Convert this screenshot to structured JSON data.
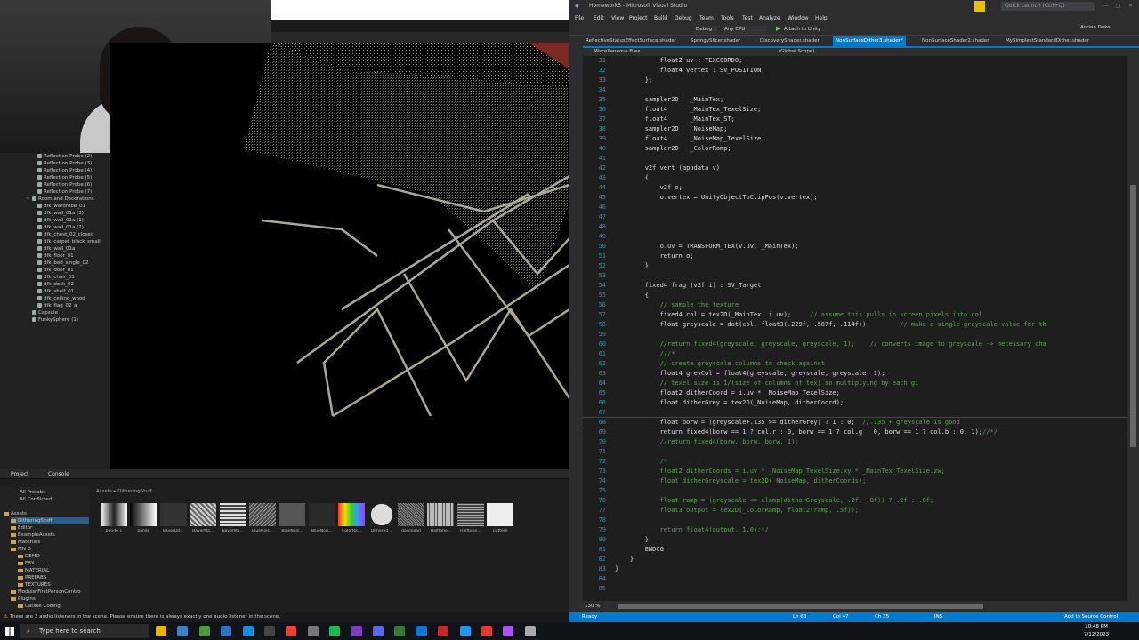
{
  "vs": {
    "title": "Homework5 - Microsoft Visual Studio",
    "quick_launch": "Quick Launch (Ctrl+Q)",
    "user": "Adrian Duke",
    "menu": [
      "File",
      "Edit",
      "View",
      "Project",
      "Build",
      "Debug",
      "Team",
      "Tools",
      "Test",
      "Analyze",
      "Window",
      "Help"
    ],
    "toolbar": {
      "config": "Debug",
      "platform": "Any CPU",
      "attach": "Attach to Unity"
    },
    "tabs": [
      "ReflectiveStatusEffectSurface.shader",
      "SpringySlicer.shader",
      "DiscoveryShader.shader",
      "NonSurfaceDither3.shader*",
      "NonSurfaceShader2.shader",
      "MySimplestStandardDither.shader"
    ],
    "nav_left": "Miscellaneous Files",
    "nav_scope": "(Global Scope)",
    "zoom": "130 %",
    "status": {
      "ready": "Ready",
      "ln": "Ln 68",
      "col": "Col 47",
      "ch": "Ch 35",
      "ins": "INS",
      "source": "Add to Source Control"
    },
    "code_lines": [
      {
        "n": "31",
        "t": "            float2 uv : TEXCOORD0;",
        "c": ""
      },
      {
        "n": "32",
        "t": "            float4 vertex : SV_POSITION;",
        "c": ""
      },
      {
        "n": "33",
        "t": "        };",
        "c": ""
      },
      {
        "n": "34",
        "t": "",
        "c": ""
      },
      {
        "n": "35",
        "t": "        sampler2D   _MainTex;",
        "c": ""
      },
      {
        "n": "36",
        "t": "        float4      _MainTex_TexelSize;",
        "c": ""
      },
      {
        "n": "37",
        "t": "        float4      _MainTex_ST;",
        "c": ""
      },
      {
        "n": "38",
        "t": "        sampler2D   _NoiseMap;",
        "c": ""
      },
      {
        "n": "39",
        "t": "        float4      _NoiseMap_TexelSize;",
        "c": ""
      },
      {
        "n": "40",
        "t": "        sampler2D   _ColorRamp;",
        "c": ""
      },
      {
        "n": "41",
        "t": "",
        "c": ""
      },
      {
        "n": "42",
        "t": "        v2f vert (appdata v)",
        "c": ""
      },
      {
        "n": "43",
        "t": "        {",
        "c": ""
      },
      {
        "n": "44",
        "t": "            v2f o;",
        "c": ""
      },
      {
        "n": "45",
        "t": "            o.vertex = UnityObjectToClipPos(v.vertex);",
        "c": ""
      },
      {
        "n": "46",
        "t": "",
        "c": ""
      },
      {
        "n": "47",
        "t": "",
        "c": ""
      },
      {
        "n": "48",
        "t": "",
        "c": ""
      },
      {
        "n": "49",
        "t": "",
        "c": ""
      },
      {
        "n": "50",
        "t": "            o.uv = TRANSFORM_TEX(v.uv, _MainTex);",
        "c": ""
      },
      {
        "n": "51",
        "t": "            return o;",
        "c": ""
      },
      {
        "n": "52",
        "t": "        }",
        "c": ""
      },
      {
        "n": "53",
        "t": "",
        "c": ""
      },
      {
        "n": "54",
        "t": "        fixed4 frag (v2f i) : SV_Target",
        "c": ""
      },
      {
        "n": "55",
        "t": "        {",
        "c": ""
      },
      {
        "n": "56",
        "t": "",
        "c": "            // sample the texture"
      },
      {
        "n": "57",
        "t": "            fixed4 col = tex2D(_MainTex, i.uv);     ",
        "c": "// assume this pulls in screen pixels into col"
      },
      {
        "n": "58",
        "t": "            float greyscale = dot(col, float3(.229f, .587f, .114f));        ",
        "c": "// make a single greyscale value for th"
      },
      {
        "n": "59",
        "t": "",
        "c": ""
      },
      {
        "n": "60",
        "t": "",
        "c": "            //return fixed4(greyscale, greyscale, greyscale, 1);    // converts image to greyscale -> necessary cha"
      },
      {
        "n": "61",
        "t": "",
        "c": "            ///*"
      },
      {
        "n": "62",
        "t": "",
        "c": "            // create greyscale columns to check against"
      },
      {
        "n": "63",
        "t": "            float4 greyCol = float4(greyscale, greyscale, greyscale, 1);",
        "c": ""
      },
      {
        "n": "64",
        "t": "",
        "c": "            // texel size is 1/(size of columns of tex) so multiplying by each gi"
      },
      {
        "n": "65",
        "t": "            float2 ditherCoord = i.uv * _NoiseMap_TexelSize;",
        "c": ""
      },
      {
        "n": "66",
        "t": "            float ditherGrey = tex2D(_NoiseMap, ditherCoord);",
        "c": ""
      },
      {
        "n": "67",
        "t": "",
        "c": ""
      },
      {
        "n": "68",
        "t": "            float borw = (greyscale+.135 >= ditherGrey) ? 1 : 0;  ",
        "c": "//.135 + greyscale is good"
      },
      {
        "n": "69",
        "t": "            return fixed4(borw == 1 ? col.r : 0, borw == 1 ? col.g : 0, borw == 1 ? col.b : 0, 1);",
        "c": "//*/"
      },
      {
        "n": "70",
        "t": "",
        "c": "            //return fixed4(borw, borw, borw, 1);"
      },
      {
        "n": "71",
        "t": "",
        "c": ""
      },
      {
        "n": "72",
        "t": "",
        "c": "            /*"
      },
      {
        "n": "73",
        "t": "",
        "c": "            float2 ditherCoords = i.uv * _NoiseMap_TexelSize.xy * _MainTex_TexelSize.zw;"
      },
      {
        "n": "74",
        "t": "",
        "c": "            float ditherGreyscale = tex2D(_NoiseMap, ditherCoords);"
      },
      {
        "n": "75",
        "t": "",
        "c": ""
      },
      {
        "n": "76",
        "t": "",
        "c": "            float ramp = (greyscale <= clamp(ditherGreyscale, .2f, .8f)) ? .2f : .8f;"
      },
      {
        "n": "77",
        "t": "",
        "c": "            float3 output = tex2D(_ColorRamp, float2(ramp, .5f));"
      },
      {
        "n": "78",
        "t": "",
        "c": ""
      },
      {
        "n": "79",
        "t": "",
        "c": "            return float4(output, 1.0);*/"
      },
      {
        "n": "80",
        "t": "        }",
        "c": ""
      },
      {
        "n": "81",
        "t": "        ENDCG",
        "c": ""
      },
      {
        "n": "82",
        "t": "    }",
        "c": ""
      },
      {
        "n": "83",
        "t": "}",
        "c": ""
      },
      {
        "n": "84",
        "t": "",
        "c": ""
      },
      {
        "n": "85",
        "t": "",
        "c": ""
      }
    ]
  },
  "unity": {
    "hierarchy": [
      "Reflection Probe (2)",
      "Reflection Probe (3)",
      "Reflection Probe (4)",
      "Reflection Probe (5)",
      "Reflection Probe (6)",
      "Reflection Probe (7)",
      "Room and Decorations",
      "dfk_wardrobe_01",
      "dfk_wall_01a (3)",
      "dfk_wall_01a (1)",
      "dfk_wall_01a (2)",
      "dfk_chest_02_closed",
      "dfk_carpet_black_small",
      "dfk_wall_01a",
      "dfk_floor_01",
      "dfk_bed_single_02",
      "dfk_door_01",
      "dfk_chair_01",
      "dfk_desk_02",
      "dfk_shelf_01",
      "dfk_ceiling_wood",
      "dfk_flag_02_a",
      "Capsule",
      "FunkySphere (1)"
    ],
    "project_tab": "Project",
    "console_tab": "Console",
    "favorites": [
      "All Prefabs",
      "All Conflicted"
    ],
    "tree": [
      "Assets",
      "DitheringStuff",
      "Editor",
      "ExampleAssets",
      "Materials",
      "MN D",
      "DEMO",
      "FBX",
      "MATERIAL",
      "PREFABS",
      "TEXTURES",
      "ModularFirstPersonContro",
      "Plugins",
      "Catlike Coding"
    ],
    "breadcrumb": [
      "Assets",
      "DitheringStuff"
    ],
    "assets": [
      "bande 1",
      "bande",
      "BayerDit...",
      "BayerMa...",
      "BayerMa...",
      "BlueNois...",
      "BlueNois...",
      "BlueNois...",
      "ColorRa...",
      "Dithered...",
      "download",
      "Halftone...",
      "Halftone...",
      "pattern"
    ],
    "status": "There are 2 audio listeners in the scene. Please ensure there is always exactly one audio listener in the scene."
  },
  "taskbar": {
    "search": "Type here to search",
    "time": "10:48 PM",
    "date": "7/12/2023"
  }
}
